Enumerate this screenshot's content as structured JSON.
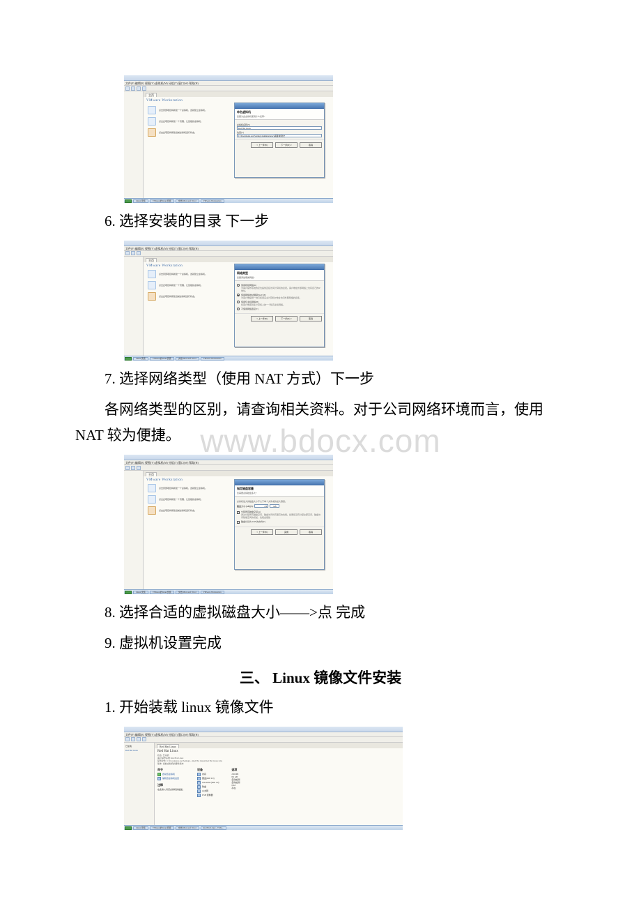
{
  "watermark": "www.bdocx.com",
  "watermark_color": "#dbdbdb",
  "step6": "6. 选择安装的目录 下一步",
  "step7": "7. 选择网络类型（使用 NAT 方式）下一步",
  "step7_note": "各网络类型的区别，请查询相关资料。对于公司网络环境而言，使用 NAT 较为便捷。",
  "step8": "8. 选择合适的虚拟磁盘大小——>点 完成",
  "step9": "9. 虚拟机设置完成",
  "section3_head": "三、 Linux 镜像文件安装",
  "s3_step1": "1. 开始装载 linux 镜像文件",
  "vm": {
    "menu": "文件(F)  编辑(E)  视图(V)  虚拟机(M)  分组(T)  窗口(W)  帮助(H)",
    "heading": "VMware Workstation",
    "tab_home": "主页",
    "feature1": "点击原因项目将新建一个虚拟机，这就建立虚拟机。",
    "feature2": "点击此项目将新建一个管理，让您组织虚拟机。",
    "feature3": "点击此项目将修建当前虚拟机运行状态。"
  },
  "dialogA": {
    "title": "命名虚拟机",
    "sub": "您要为此虚拟机使用什么名称?",
    "label_name": "虚拟机名称(V)",
    "value_name": "Red Hat Linux",
    "label_loc": "位置(L)",
    "value_loc": "C:\\Documents and Settings\\Administrator\\桌面\\新建文",
    "btn_back": "< 上一步(B)",
    "btn_next": "下一步(N) >",
    "btn_cancel": "取消"
  },
  "dialogB": {
    "title": "网络类型",
    "sub": "您要添加哪类网络?",
    "opt1_head": "使用桥接网络(R)",
    "opt1_desc": "为客户操作系统的定位提供直接访问计算机的途径。客户端在外部网络上也有自己的IP地址。",
    "opt2_head": "使用网络地址翻译(NAT)(E)",
    "opt2_desc": "为客户端提供一种可使用来主计算机IP地址访问外部网络的途径。",
    "opt3_head": "使用仅主机网络(H)",
    "opt3_desc": "将客户端连到主计算机上的一个私有虚拟网络。",
    "opt4_head": "不使用网络连接(T)",
    "btn_back": "< 上一步(B)",
    "btn_next": "下一步(N) >",
    "btn_cancel": "取消"
  },
  "dialogC": {
    "title": "指定磁盘容量",
    "sub": "您需要虚拟磁盘多大?",
    "note_top": "虚拟机最大的磁盘大小不大于单个文件或的最大容量。",
    "label_size": "磁盘大小 (GB)(S):",
    "value_size": "8.0",
    "unit": "GB",
    "opt1_head": "分配所有磁盘空间(A)",
    "opt1_desc": "通过分配所有磁盘空间，磁盘访问将有更高的性能。如果您没有分配全部空间，磁盘访问随着空间的增加，性能会慢些",
    "opt2_head": "磁盘分割为 2GB 的文件(P)",
    "btn_back": "< 上一步(B)",
    "btn_finish": "完成",
    "btn_cancel": "取消"
  },
  "shotD": {
    "sidebar_label": "已加电",
    "sidebar_item": "Red Hat Linux",
    "tab": "Red Hat Linux",
    "title": "Red Hat Linux",
    "state_label": "状态:",
    "state_value": "已关机",
    "os_label": "客户操作系统:",
    "os_value": "Red Hat Linux",
    "cfg_label": "配置文件:",
    "cfg_value": "C:\\Documents and Settings\\...\\Red Hat Linux\\Red Hat Linux.vmx",
    "ver_label": "版本:",
    "ver_value": "当前虚拟机的硬件版本",
    "cmd_section": "命令",
    "cmd_start": "启动该虚拟机",
    "cmd_edit": "编辑该虚拟机设置",
    "dev_section": "设备",
    "dev_mem_k": "内存",
    "dev_mem_v": "256 MB",
    "dev_hd_k": "硬盘(IDE 0:0)",
    "dev_hd_v": "8.0 GB",
    "dev_cd_k": "CD-ROM (IDE 1:0)",
    "dev_cd_v": "自动检测",
    "dev_fd_k": "软盘",
    "dev_fd_v": "自动检测",
    "dev_net_k": "以太网",
    "dev_net_v": "NAT",
    "dev_usb_k": "USB 控制器",
    "dev_usb_v": "存在",
    "opt_section": "选项",
    "opt_value": "已关机",
    "notes_label": "注释",
    "notes_value": "在此输入对该虚拟机的描述。"
  },
  "taskbar": {
    "item1": "Linux 安装",
    "item2": "VMware的Linux安装",
    "item3": "文档 Microsoft Word",
    "item4": "VMware Workstation",
    "item5": "Red Hat Linux - VMw..."
  }
}
